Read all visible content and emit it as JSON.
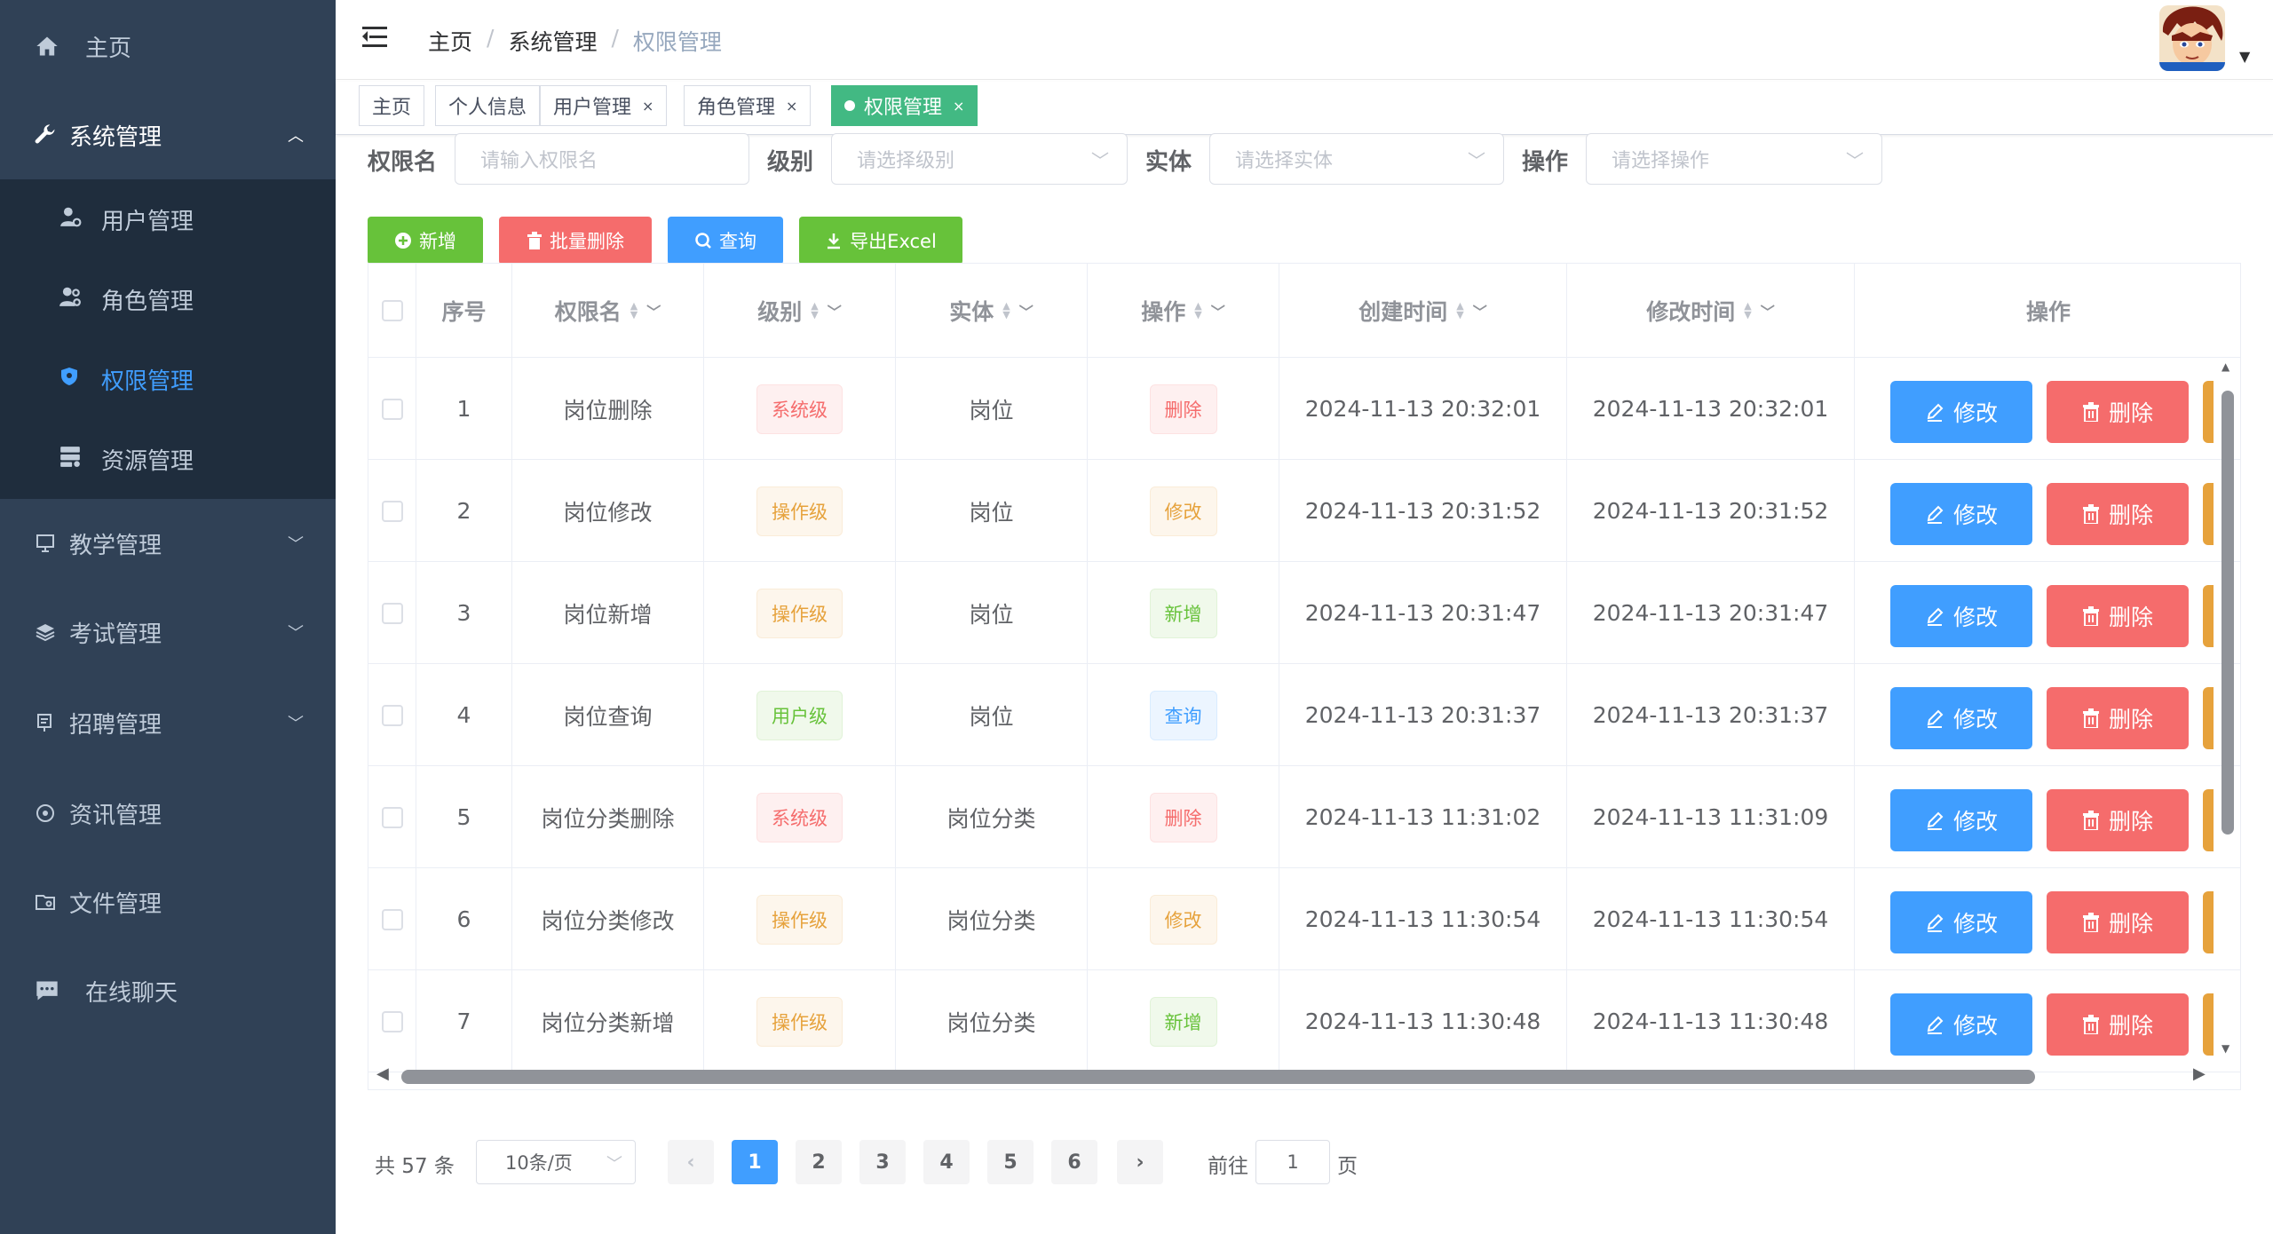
{
  "sidebar": {
    "home": "主页",
    "system": "系统管理",
    "sub_items": [
      "用户管理",
      "角色管理",
      "权限管理",
      "资源管理"
    ],
    "teaching": "教学管理",
    "exam": "考试管理",
    "recruit": "招聘管理",
    "news": "资讯管理",
    "files": "文件管理",
    "chat": "在线聊天"
  },
  "breadcrumb": [
    "主页",
    "系统管理",
    "权限管理"
  ],
  "tags": [
    "主页",
    "个人信息",
    "用户管理",
    "角色管理",
    "权限管理"
  ],
  "filters": {
    "name_label": "权限名",
    "name_placeholder": "请输入权限名",
    "level_label": "级别",
    "level_placeholder": "请选择级别",
    "entity_label": "实体",
    "entity_placeholder": "请选择实体",
    "op_label": "操作",
    "op_placeholder": "请选择操作"
  },
  "actions": {
    "add": "新增",
    "batch_delete": "批量删除",
    "query": "查询",
    "export": "导出Excel"
  },
  "table": {
    "headers": [
      "序号",
      "权限名",
      "级别",
      "实体",
      "操作",
      "创建时间",
      "修改时间",
      "操作"
    ],
    "edit_label": "修改",
    "delete_label": "删除",
    "rows": [
      {
        "no": "1",
        "name": "岗位删除",
        "level": "系统级",
        "entity": "岗位",
        "op": "删除",
        "created": "2024-11-13 20:32:01",
        "modified": "2024-11-13 20:32:01"
      },
      {
        "no": "2",
        "name": "岗位修改",
        "level": "操作级",
        "entity": "岗位",
        "op": "修改",
        "created": "2024-11-13 20:31:52",
        "modified": "2024-11-13 20:31:52"
      },
      {
        "no": "3",
        "name": "岗位新增",
        "level": "操作级",
        "entity": "岗位",
        "op": "新增",
        "created": "2024-11-13 20:31:47",
        "modified": "2024-11-13 20:31:47"
      },
      {
        "no": "4",
        "name": "岗位查询",
        "level": "用户级",
        "entity": "岗位",
        "op": "查询",
        "created": "2024-11-13 20:31:37",
        "modified": "2024-11-13 20:31:37"
      },
      {
        "no": "5",
        "name": "岗位分类删除",
        "level": "系统级",
        "entity": "岗位分类",
        "op": "删除",
        "created": "2024-11-13 11:31:02",
        "modified": "2024-11-13 11:31:09"
      },
      {
        "no": "6",
        "name": "岗位分类修改",
        "level": "操作级",
        "entity": "岗位分类",
        "op": "修改",
        "created": "2024-11-13 11:30:54",
        "modified": "2024-11-13 11:30:54"
      },
      {
        "no": "7",
        "name": "岗位分类新增",
        "level": "操作级",
        "entity": "岗位分类",
        "op": "新增",
        "created": "2024-11-13 11:30:48",
        "modified": "2024-11-13 11:30:48"
      }
    ]
  },
  "pagination": {
    "total": "共 57 条",
    "page_size": "10条/页",
    "pages": [
      "1",
      "2",
      "3",
      "4",
      "5",
      "6"
    ],
    "current": "1",
    "goto_prefix": "前往",
    "goto_value": "1",
    "goto_suffix": "页"
  },
  "colors": {
    "sidebar_bg": "#304156",
    "primary": "#409eff",
    "success": "#67c23a",
    "danger": "#f56c6c",
    "warning": "#e6a23c",
    "active_tag": "#42b983"
  }
}
